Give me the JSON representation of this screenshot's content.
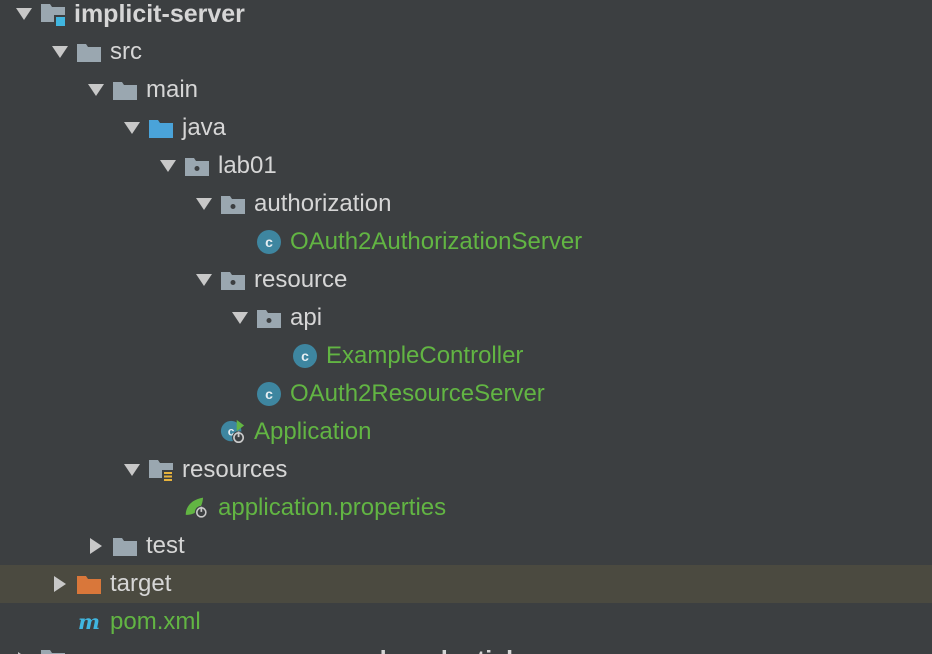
{
  "tree": {
    "items": [
      {
        "label": "implicit-server",
        "depth": 0,
        "expanded": true,
        "icon": "module-folder-icon",
        "style": "bold"
      },
      {
        "label": "src",
        "depth": 1,
        "expanded": true,
        "icon": "folder-icon"
      },
      {
        "label": "main",
        "depth": 2,
        "expanded": true,
        "icon": "folder-icon"
      },
      {
        "label": "java",
        "depth": 3,
        "expanded": true,
        "icon": "source-folder-icon"
      },
      {
        "label": "lab01",
        "depth": 4,
        "expanded": true,
        "icon": "package-icon"
      },
      {
        "label": "authorization",
        "depth": 5,
        "expanded": true,
        "icon": "package-icon"
      },
      {
        "label": "OAuth2AuthorizationServer",
        "depth": 6,
        "icon": "java-class-icon",
        "style": "green"
      },
      {
        "label": "resource",
        "depth": 5,
        "expanded": true,
        "icon": "package-icon"
      },
      {
        "label": "api",
        "depth": 6,
        "expanded": true,
        "icon": "package-icon"
      },
      {
        "label": "ExampleController",
        "depth": 7,
        "icon": "java-class-icon",
        "style": "green"
      },
      {
        "label": "OAuth2ResourceServer",
        "depth": 6,
        "icon": "java-class-icon",
        "style": "green"
      },
      {
        "label": "Application",
        "depth": 5,
        "icon": "spring-boot-class-icon",
        "style": "green"
      },
      {
        "label": "resources",
        "depth": 3,
        "expanded": true,
        "icon": "resources-folder-icon"
      },
      {
        "label": "application.properties",
        "depth": 4,
        "icon": "spring-properties-icon",
        "style": "green"
      },
      {
        "label": "test",
        "depth": 2,
        "expanded": false,
        "icon": "folder-icon"
      },
      {
        "label": "target",
        "depth": 1,
        "expanded": false,
        "icon": "excluded-folder-icon",
        "selected": true
      },
      {
        "label": "pom.xml",
        "depth": 1,
        "icon": "maven-icon",
        "style": "green"
      },
      {
        "label": "resource-owner-password-credentials-server",
        "depth": 0,
        "expanded": false,
        "icon": "module-folder-icon",
        "style": "bold"
      }
    ]
  },
  "colors": {
    "background": "#3c3f41",
    "selected_row": "#4b4a40",
    "text": "#d6d6d6",
    "green_text": "#62b543",
    "folder_gray": "#9aa7b0",
    "source_folder_blue": "#4aa3d9",
    "class_blue": "#3e86a0",
    "excluded_orange": "#d9773a",
    "maven_blue": "#40b6e0"
  }
}
